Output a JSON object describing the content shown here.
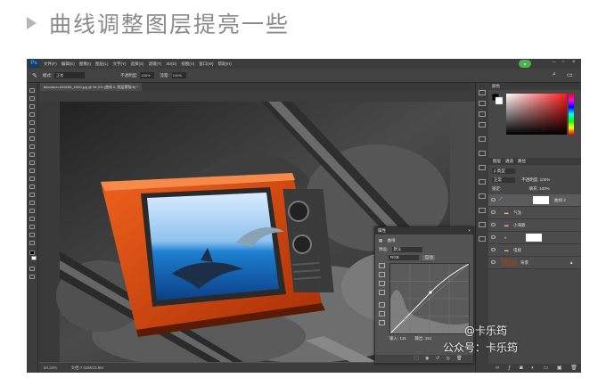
{
  "heading": {
    "text": "曲线调整图层提亮一些"
  },
  "ps": {
    "logo": "Ps",
    "menu": [
      "文件(F)",
      "编辑(E)",
      "图像(I)",
      "图层(L)",
      "文字(Y)",
      "选择(S)",
      "滤镜(T)",
      "3D(D)",
      "视图(V)",
      "窗口(W)",
      "帮助(H)"
    ],
    "options": {
      "mode_label": "模式:",
      "mode_value": "正常",
      "opacity_label": "不透明度:",
      "opacity_value": "100%",
      "flow_label": "流量:",
      "flow_value": "100%"
    },
    "doc_tab": "television-899285_1920.jpg @ 54.2% (曲线 2, 图层蒙版/8) *",
    "status": {
      "zoom": "54.34%",
      "doc_size": "文档:7.03M/23.8M"
    },
    "panels": {
      "color_tab": "颜色",
      "layers_tabs": [
        "图层",
        "通道",
        "路径"
      ],
      "kind_label": "ρ 类型",
      "blend": "正常",
      "opacity_label": "不透明度:",
      "opacity_value": "100%",
      "lock_label": "锁定:",
      "fill_label": "填充:",
      "fill_value": "100%",
      "layers": [
        {
          "name": "曲线 2"
        },
        {
          "name": "气泡"
        },
        {
          "name": "小海豚"
        },
        {
          "name": ""
        },
        {
          "name": "电视"
        },
        {
          "name": "背景"
        }
      ]
    },
    "properties": {
      "tab": "属性",
      "title": "曲线",
      "preset_label": "预设:",
      "preset_value": "默认",
      "channel_value": "RGB",
      "auto_label": "自动",
      "input_label": "输入:",
      "input_value": "131",
      "output_label": "输出:",
      "output_value": "151"
    }
  },
  "watermarks": [
    "@卡乐筠",
    "公众号：卡乐筠"
  ],
  "colors": {
    "ps_bg": "#535353",
    "ps_dark": "#3c3c3c",
    "tv_orange": "#d9460f",
    "ps_blue": "#31a8ff"
  },
  "icons": [
    "triangle-bullet-icon",
    "move-tool-icon",
    "brush-tool-icon",
    "curves-icon",
    "eye-icon",
    "folder-icon",
    "close-icon",
    "minimize-icon",
    "maximize-icon",
    "search-icon"
  ]
}
